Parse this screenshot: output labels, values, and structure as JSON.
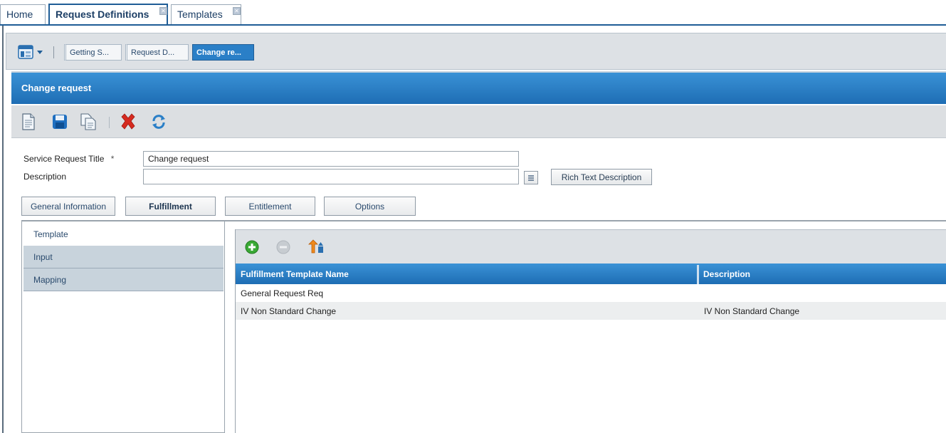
{
  "tabs": [
    {
      "label": "Home",
      "closable": false,
      "active": false
    },
    {
      "label": "Request Definitions",
      "closable": true,
      "active": true
    },
    {
      "label": "Templates",
      "closable": true,
      "active": false
    }
  ],
  "breadcrumbs": [
    {
      "label": "Getting S...",
      "active": false
    },
    {
      "label": "Request D...",
      "active": false
    },
    {
      "label": "Change re...",
      "active": true
    }
  ],
  "header": {
    "title": "Change request"
  },
  "toolbar": {
    "icons": [
      "new-document-icon",
      "save-icon",
      "copy-icon",
      "delete-icon",
      "refresh-icon"
    ]
  },
  "form": {
    "title_label": "Service Request Title",
    "required_mark": "*",
    "title_value": "Change request",
    "description_label": "Description",
    "description_value": "",
    "rich_text_button": "Rich Text Description"
  },
  "subtabs": [
    {
      "label": "General Information",
      "active": false
    },
    {
      "label": "Fulfillment",
      "active": true
    },
    {
      "label": "Entitlement",
      "active": false
    },
    {
      "label": "Options",
      "active": false
    }
  ],
  "leftnav": [
    {
      "label": "Template",
      "selected": true
    },
    {
      "label": "Input",
      "selected": false
    },
    {
      "label": "Mapping",
      "selected": false
    }
  ],
  "grid": {
    "columns": [
      "Fulfillment Template Name",
      "Description"
    ],
    "rows": [
      {
        "name": "General Request Req",
        "description": ""
      },
      {
        "name": "IV Non Standard Change",
        "description": "IV Non Standard Change"
      }
    ]
  },
  "colors": {
    "accent": "#1e6db4",
    "header_blue": "#3a92d6",
    "toolbar_grey": "#dcdfe2"
  }
}
